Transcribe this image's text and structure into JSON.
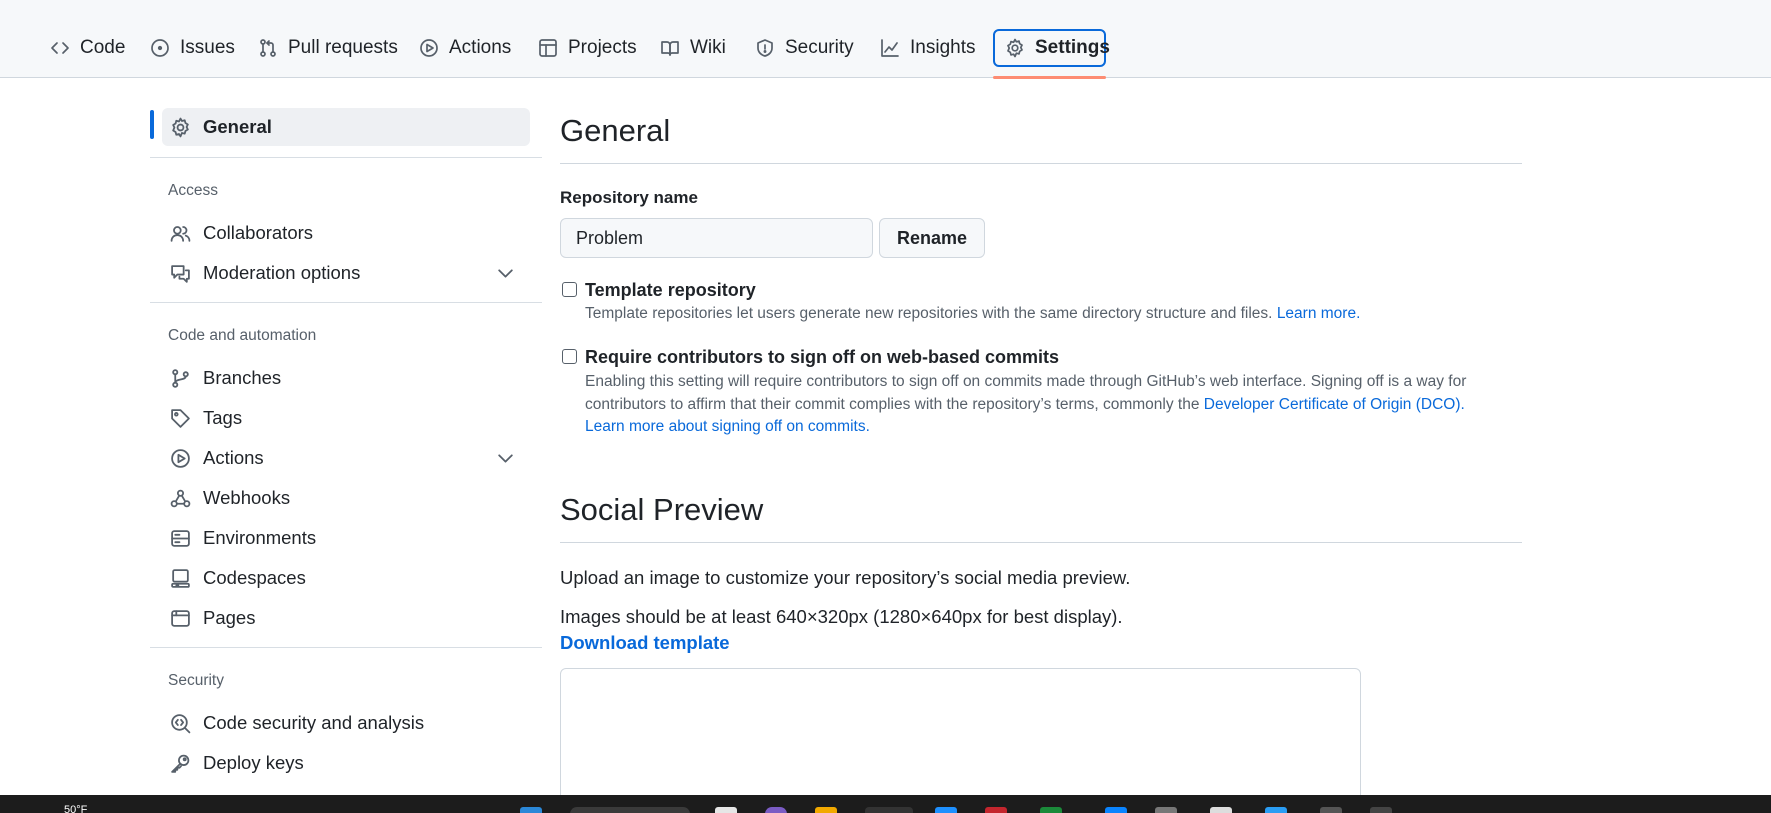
{
  "repo_nav": {
    "tabs": [
      {
        "label": "Code",
        "icon": "code-icon"
      },
      {
        "label": "Issues",
        "icon": "issue-opened-icon"
      },
      {
        "label": "Pull requests",
        "icon": "git-pull-request-icon"
      },
      {
        "label": "Actions",
        "icon": "play-icon"
      },
      {
        "label": "Projects",
        "icon": "table-icon"
      },
      {
        "label": "Wiki",
        "icon": "book-icon"
      },
      {
        "label": "Security",
        "icon": "shield-icon"
      },
      {
        "label": "Insights",
        "icon": "graph-icon"
      },
      {
        "label": "Settings",
        "icon": "gear-icon"
      }
    ],
    "active_tab": "Settings"
  },
  "sidebar": {
    "general": {
      "label": "General",
      "icon": "gear-icon"
    },
    "sections": [
      {
        "heading": "Access",
        "items": [
          {
            "label": "Collaborators",
            "icon": "people-icon"
          },
          {
            "label": "Moderation options",
            "icon": "comment-discussion-icon",
            "expandable": true
          }
        ]
      },
      {
        "heading": "Code and automation",
        "items": [
          {
            "label": "Branches",
            "icon": "git-branch-icon"
          },
          {
            "label": "Tags",
            "icon": "tag-icon"
          },
          {
            "label": "Actions",
            "icon": "play-icon",
            "expandable": true
          },
          {
            "label": "Webhooks",
            "icon": "webhook-icon"
          },
          {
            "label": "Environments",
            "icon": "server-icon"
          },
          {
            "label": "Codespaces",
            "icon": "codespaces-icon"
          },
          {
            "label": "Pages",
            "icon": "browser-icon"
          }
        ]
      },
      {
        "heading": "Security",
        "items": [
          {
            "label": "Code security and analysis",
            "icon": "codescan-icon"
          },
          {
            "label": "Deploy keys",
            "icon": "key-icon"
          }
        ]
      }
    ]
  },
  "main": {
    "general_heading": "General",
    "repo_name_label": "Repository name",
    "repo_name_value": "Problem",
    "rename_button": "Rename",
    "template": {
      "title": "Template repository",
      "description": "Template repositories let users generate new repositories with the same directory structure and files.",
      "link": "Learn more.",
      "checked": false
    },
    "signoff": {
      "title": "Require contributors to sign off on web-based commits",
      "description": "Enabling this setting will require contributors to sign off on commits made through GitHub’s web interface. Signing off is a way for contributors to affirm that their commit complies with the repository’s terms, commonly the",
      "link_dco": "Developer Certificate of Origin (DCO).",
      "link_more": "Learn more about signing off on commits.",
      "checked": false
    },
    "social_heading": "Social Preview",
    "social_desc": "Upload an image to customize your repository’s social media preview.",
    "social_req": "Images should be at least 640×320px (1280×640px for best display).",
    "download_template": "Download template"
  },
  "taskbar": {
    "weather": "50°F"
  },
  "colors": {
    "accent": "#0969da",
    "tab_underline": "#fd8c73",
    "muted_text": "#57606a",
    "border": "#d0d7de"
  }
}
